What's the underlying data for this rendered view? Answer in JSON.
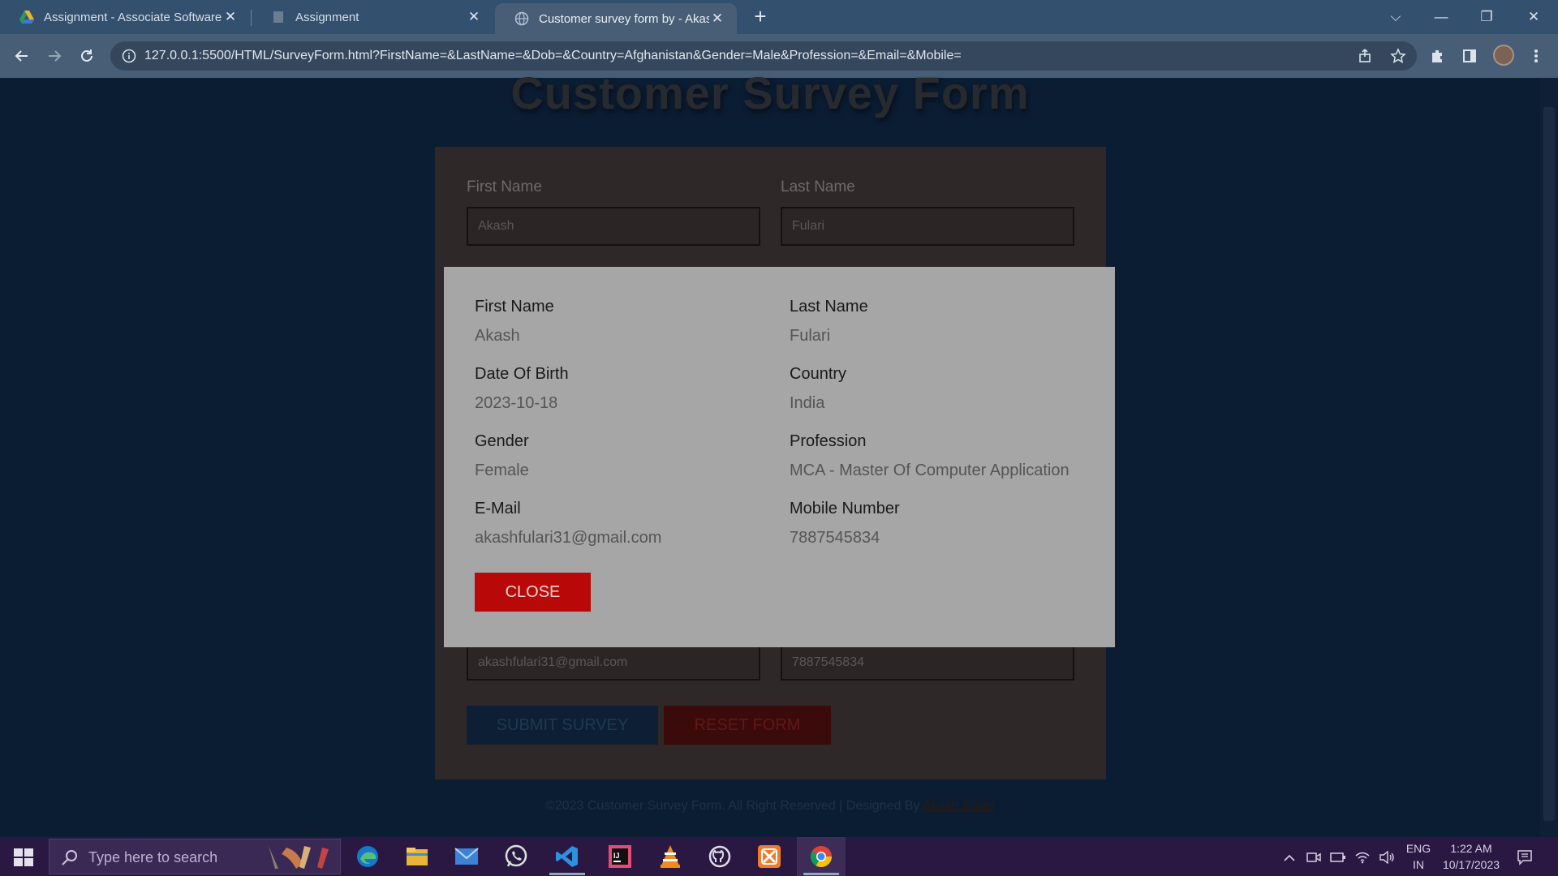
{
  "browser": {
    "tabs": [
      {
        "label": "Assignment - Associate Software",
        "icon": "google-drive-icon"
      },
      {
        "label": "Assignment",
        "icon": "document-icon"
      },
      {
        "label": "Customer survey form by - Akash",
        "icon": "globe-icon"
      }
    ],
    "url": "127.0.0.1:5500/HTML/SurveyForm.html?FirstName=&LastName=&Dob=&Country=Afghanistan&Gender=Male&Profession=&Email=&Mobile="
  },
  "page": {
    "title": "Customer Survey Form",
    "form": {
      "first_name_label": "First Name",
      "last_name_label": "Last Name",
      "first_name_value": "Akash",
      "last_name_value": "Fulari",
      "email_value": "akashfulari31@gmail.com",
      "mobile_value": "7887545834",
      "submit_label": "SUBMIT SURVEY",
      "reset_label": "RESET FORM"
    },
    "footer": {
      "text": "©2023 Customer Survey Form. All Right Reserved | Designed By ",
      "author": "Akash Fulari"
    }
  },
  "modal": {
    "fields": [
      {
        "label": "First Name",
        "value": "Akash"
      },
      {
        "label": "Last Name",
        "value": "Fulari"
      },
      {
        "label": "Date Of Birth",
        "value": "2023-10-18"
      },
      {
        "label": "Country",
        "value": "India"
      },
      {
        "label": "Gender",
        "value": "Female"
      },
      {
        "label": "Profession",
        "value": "MCA - Master Of Computer Application"
      },
      {
        "label": "E-Mail",
        "value": "akashfulari31@gmail.com"
      },
      {
        "label": "Mobile Number",
        "value": "7887545834"
      }
    ],
    "close_label": "CLOSE"
  },
  "taskbar": {
    "search_placeholder": "Type here to search",
    "apps": [
      "edge-icon",
      "file-explorer-icon",
      "mail-icon",
      "whatsapp-icon",
      "vscode-icon",
      "intellij-icon",
      "vlc-icon",
      "github-icon",
      "xampp-icon",
      "chrome-icon"
    ],
    "tray": {
      "language": "ENG",
      "region": "IN",
      "time": "1:22 AM",
      "date": "10/17/2023"
    }
  }
}
